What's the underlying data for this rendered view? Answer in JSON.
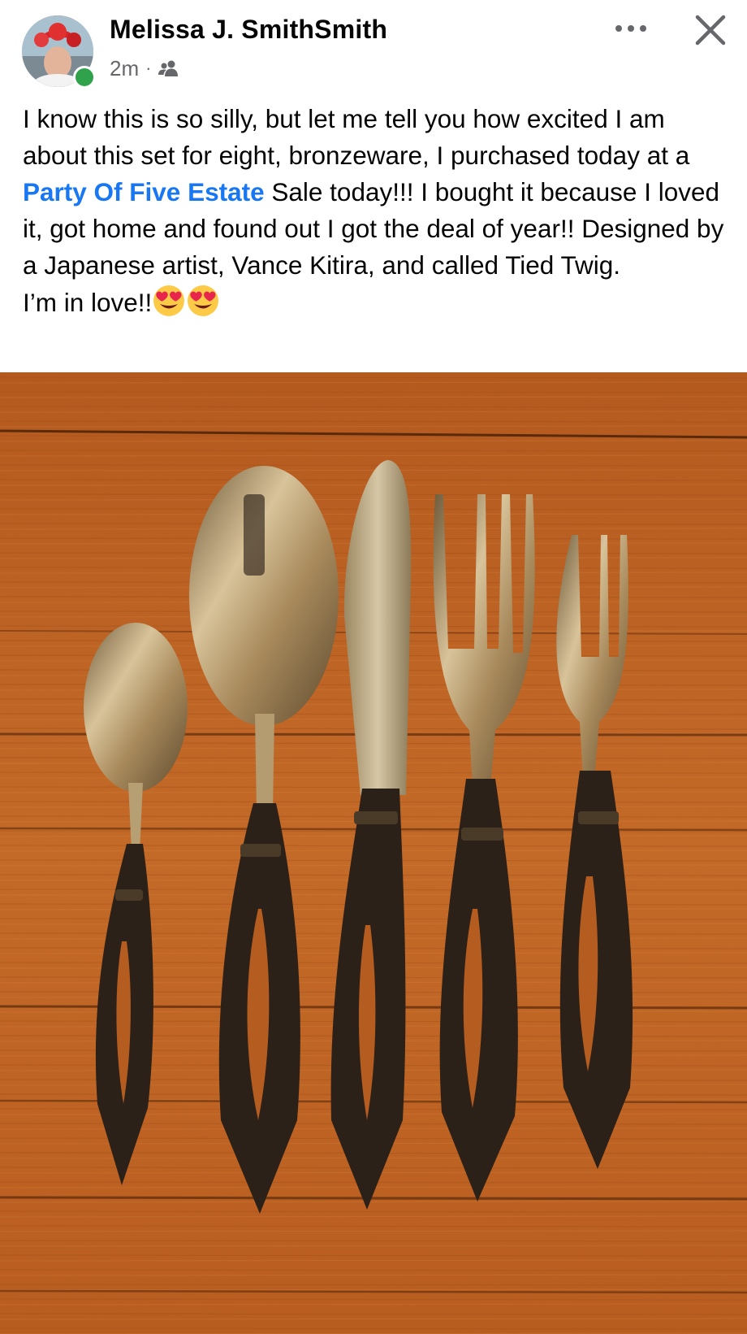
{
  "post": {
    "author": "Melissa J. SmithSmith",
    "time": "2m",
    "separator": "·",
    "audience_icon": "friends-icon",
    "text_part1": "I know this is so silly, but let me tell you how excited I am about this set for eight, bronzeware, I purchased today at a ",
    "link_text": "Party Of Five Estate",
    "text_part2": " Sale today!!! I bought it because I loved it, got home and found out I got the deal of year!! Designed by a Japanese artist, Vance Kitira, and called Tied Twig.",
    "text_part3": "I’m in love!!",
    "emojis": [
      "heart-eyes-emoji",
      "heart-eyes-emoji"
    ]
  },
  "colors": {
    "link": "#1877f2",
    "online": "#31a24c",
    "meta": "#65676b"
  }
}
